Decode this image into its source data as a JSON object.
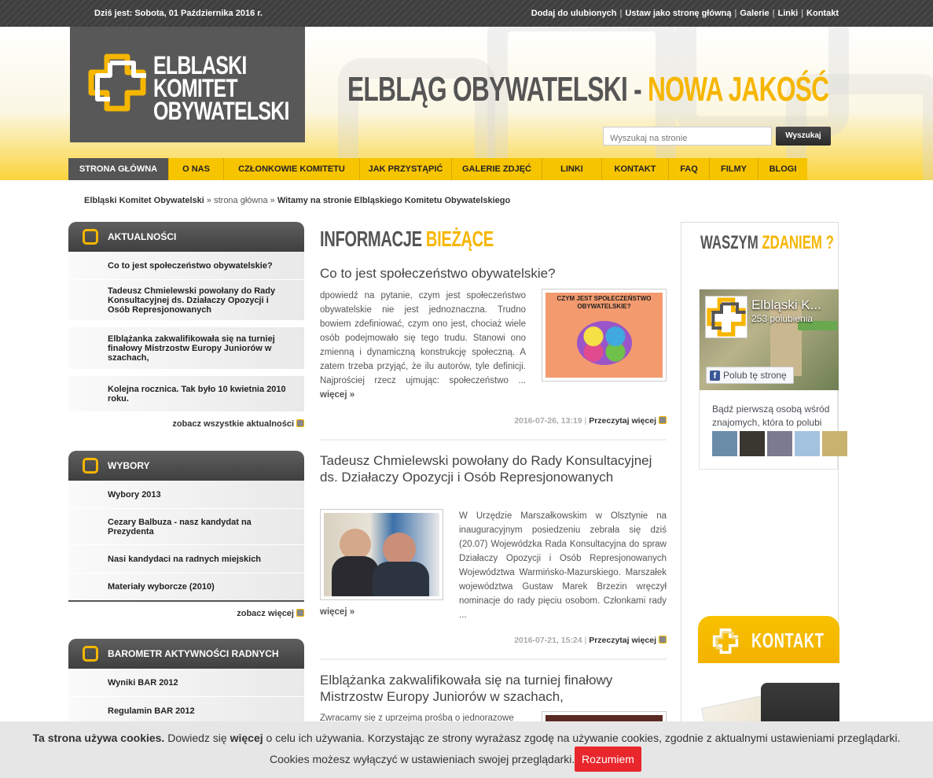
{
  "topbar": {
    "date": "Dziś jest: Sobota, 01 Października 2016 r.",
    "links": [
      "Dodaj do ulubionych",
      "Ustaw jako stronę główną",
      "Galerie",
      "Linki",
      "Kontakt"
    ]
  },
  "header": {
    "logo_lines": [
      "ELBLASKI",
      "KOMITET",
      "OBYWATELSKI"
    ],
    "slogan_part1": "ELBLĄG OBYWATELSKI -",
    "slogan_part2": "NOWA JAKOŚĆ",
    "search_placeholder": "Wyszukaj na stronie",
    "search_button": "Wyszukaj"
  },
  "nav": [
    {
      "label": "STRONA GŁÓWNA",
      "active": true
    },
    {
      "label": "O NAS"
    },
    {
      "label": "CZŁONKOWIE KOMITETU"
    },
    {
      "label": "JAK PRZYSTĄPIĆ"
    },
    {
      "label": "GALERIE ZDJĘĆ"
    },
    {
      "label": "LINKI"
    },
    {
      "label": "KONTAKT"
    },
    {
      "label": "FAQ"
    },
    {
      "label": "FILMY"
    },
    {
      "label": "BLOGI"
    }
  ],
  "breadcrumb": {
    "home": "Elbląski Komitet Obywatelski",
    "sep": "»",
    "mid": "strona główna",
    "current": "Witamy na stronie Elbląskiego Komitetu Obywatelskiego"
  },
  "sidebar": {
    "news": {
      "title": "AKTUALNOŚCI",
      "items": [
        "Co to jest społeczeństwo obywatelskie?",
        "Tadeusz Chmielewski powołany do Rady Konsultacyjnej ds. Działaczy Opozycji i Osób Represjonowanych",
        "Elblążanka zakwalifikowała się na turniej finałowy Mistrzostw Europy Juniorów w szachach,",
        "Kolejna rocznica. Tak było 10 kwietnia 2010 roku."
      ],
      "more": "zobacz wszystkie aktualności"
    },
    "elections": {
      "title": "WYBORY",
      "items": [
        "Wybory 2013",
        "Cezary Balbuza - nasz kandydat na Prezydenta",
        "Nasi kandydaci na radnych miejskich",
        "Materiały wyborcze (2010)"
      ],
      "more": "zobacz więcej"
    },
    "barometer": {
      "title": "BAROMETR AKTYWNOŚCI RADNYCH",
      "items": [
        "Wyniki BAR 2012",
        "Regulamin BAR 2012"
      ]
    }
  },
  "main": {
    "section_title_part1": "INFORMACJE",
    "section_title_part2": "BIEŻĄCE",
    "articles": [
      {
        "title": "Co to jest społeczeństwo obywatelskie?",
        "text": "dpowiedź na pytanie, czym jest społeczeństwo obywatelskie nie jest jednoznaczna. Trudno bowiem zdefiniować, czym ono jest, chociaż wiele osób podejmowało się tego trudu. Stanowi ono zmienną i dynamiczną konstrukcję społeczną. A zatem trzeba przyjąć, że ilu autorów, tyle definicji. Najprościej rzecz ujmując: społeczeństwo ...",
        "more": "więcej »",
        "date": "2016-07-26, 13:19",
        "read_more": "Przeczytaj więcej",
        "thumb_caption": "CZYM JEST SPOŁECZEŃSTWO OBYWATELSKIE?"
      },
      {
        "title": "Tadeusz Chmielewski powołany do Rady Konsultacyjnej ds. Działaczy Opozycji i Osób Represjonowanych",
        "text": "W Urzędzie Marszałkowskim w Olsztynie na inauguracyjnym posiedzeniu zebrała się dziś (20.07) Wojewódzka Rada Konsultacyjna do spraw Działaczy Opozycji i Osób Represjonowanych Województwa Warmińsko-Mazurskiego. Marszałek województwa Gustaw Marek Brzezin wręczył nominacje do rady pięciu osobom. Członkami rady ...",
        "more": "więcej »",
        "date": "2016-07-21, 15:24",
        "read_more": "Przeczytaj więcej"
      },
      {
        "title": "Elblążanka zakwalifikowała się na turniej finałowy Mistrzostw Europy Juniorów w szachach,",
        "text": "Zwracamy się z uprzejmą prośbą o jednorazowe"
      }
    ]
  },
  "right": {
    "opinion_part1": "WASZYM",
    "opinion_part2": "ZDANIEM ?",
    "fb": {
      "page_name": "Elbląski K...",
      "likes": "253 polubienia",
      "like_button": "Polub tę stronę",
      "friends_text": "Bądź pierwszą osobą wśród znajomych, która to polubi"
    },
    "kontakt": "KONTAKT"
  },
  "cookie": {
    "bold1": "Ta strona używa cookies.",
    "text1": " Dowiedz się ",
    "bold2": "więcej",
    "text2": " o celu ich używania. Korzystając ze strony wyrażasz zgodę na używanie cookies, zgodnie z aktualnymi ustawieniami przeglądarki.",
    "line2": "Cookies możesz wyłączyć w ustawieniach swojej przeglądarki.",
    "button": "Rozumiem"
  },
  "colors": {
    "accent": "#f6b600",
    "dark": "#4a4a4a",
    "cookie_button": "#e8262c"
  }
}
